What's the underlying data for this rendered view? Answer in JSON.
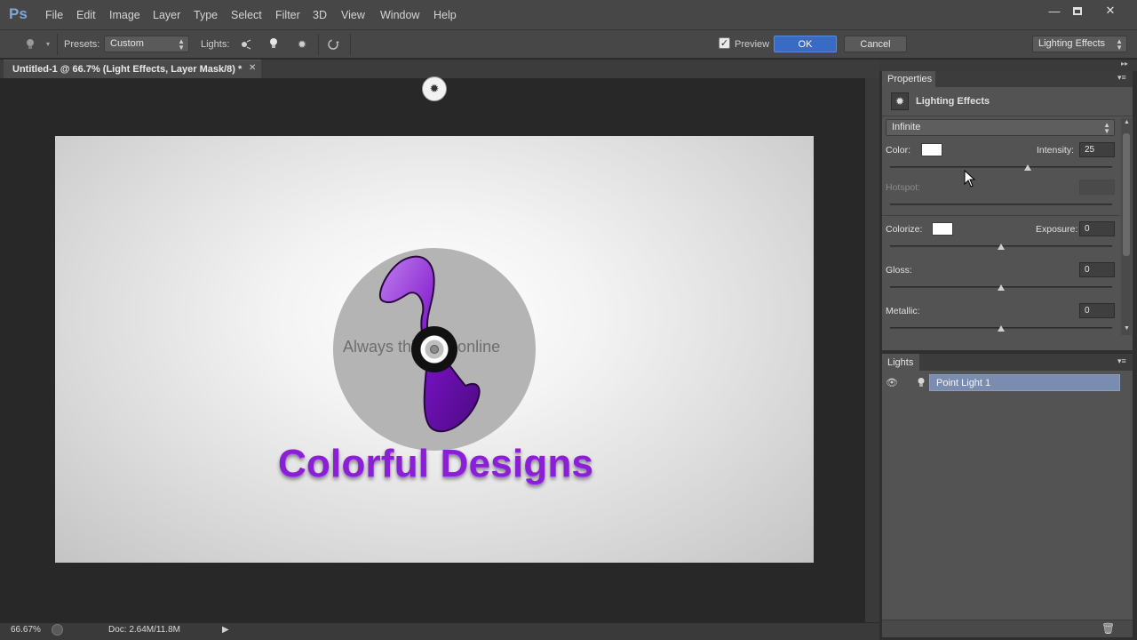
{
  "app": {
    "logo": "Ps",
    "menu": [
      "File",
      "Edit",
      "Image",
      "Layer",
      "Type",
      "Select",
      "Filter",
      "3D",
      "View",
      "Window",
      "Help"
    ]
  },
  "options_bar": {
    "presets_label": "Presets:",
    "presets_value": "Custom",
    "lights_label": "Lights:",
    "preview_label": "Preview",
    "preview_checked": true,
    "ok_label": "OK",
    "cancel_label": "Cancel",
    "workspace_value": "Lighting Effects"
  },
  "document": {
    "tab_title": "Untitled-1 @ 66.7% (Light Effects, Layer Mask/8) *",
    "tagline": "Always thinking online",
    "brand_name": "Colorful Designs"
  },
  "status": {
    "zoom": "66.67%",
    "doc_size": "Doc: 2.64M/11.8M"
  },
  "properties": {
    "tab_label": "Properties",
    "panel_title": "Lighting Effects",
    "light_type": "Infinite",
    "color_label": "Color:",
    "intensity_label": "Intensity:",
    "intensity_value": "25",
    "intensity_slider": 0.62,
    "hotspot_label": "Hotspot:",
    "colorize_label": "Colorize:",
    "exposure_label": "Exposure:",
    "exposure_value": "0",
    "exposure_slider": 0.5,
    "gloss_label": "Gloss:",
    "gloss_value": "0",
    "gloss_slider": 0.5,
    "metallic_label": "Metallic:",
    "metallic_value": "0",
    "metallic_slider": 0.5
  },
  "lights_panel": {
    "tab_label": "Lights",
    "items": [
      {
        "label": "Point Light 1",
        "visible": true
      }
    ]
  },
  "colors": {
    "brand_purple": "#8b1fd6",
    "ok_blue": "#3a6bc4",
    "selection_blue": "#7a8db1"
  }
}
